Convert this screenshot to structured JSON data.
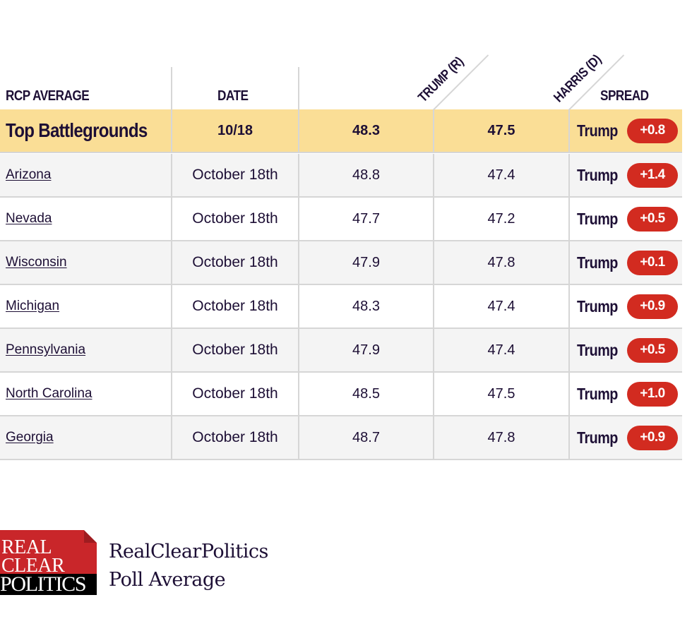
{
  "header": {
    "col_rcp_average": "RCP AVERAGE",
    "col_date": "DATE",
    "col_trump": "TRUMP (R)",
    "col_harris": "HARRIS (D)",
    "col_spread": "SPREAD"
  },
  "summary": {
    "name": "Top Battlegrounds",
    "date": "10/18",
    "trump": "48.3",
    "harris": "47.5",
    "leader": "Trump",
    "spread": "+0.8"
  },
  "rows": [
    {
      "state": "Arizona",
      "date": "October 18th",
      "trump": "48.8",
      "harris": "47.4",
      "leader": "Trump",
      "spread": "+1.4"
    },
    {
      "state": "Nevada",
      "date": "October 18th",
      "trump": "47.7",
      "harris": "47.2",
      "leader": "Trump",
      "spread": "+0.5"
    },
    {
      "state": "Wisconsin",
      "date": "October 18th",
      "trump": "47.9",
      "harris": "47.8",
      "leader": "Trump",
      "spread": "+0.1"
    },
    {
      "state": "Michigan",
      "date": "October 18th",
      "trump": "48.3",
      "harris": "47.4",
      "leader": "Trump",
      "spread": "+0.9"
    },
    {
      "state": "Pennsylvania",
      "date": "October 18th",
      "trump": "47.9",
      "harris": "47.4",
      "leader": "Trump",
      "spread": "+0.5"
    },
    {
      "state": "North Carolina",
      "date": "October 18th",
      "trump": "48.5",
      "harris": "47.5",
      "leader": "Trump",
      "spread": "+1.0"
    },
    {
      "state": "Georgia",
      "date": "October 18th",
      "trump": "48.7",
      "harris": "47.8",
      "leader": "Trump",
      "spread": "+0.9"
    }
  ],
  "colors": {
    "republican_badge": "#d22b20",
    "summary_row": "#fade96",
    "text": "#1d0f35"
  },
  "footer": {
    "logo_line1": "REAL",
    "logo_line2": "CLEAR",
    "logo_line3": "POLITICS",
    "brand_name": "RealClearPolitics",
    "brand_subtitle": "Poll Average"
  }
}
